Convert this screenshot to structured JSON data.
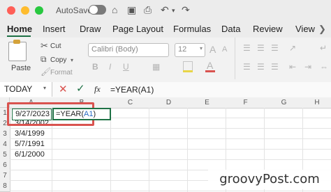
{
  "titlebar": {
    "autosave_label": "AutoSave"
  },
  "ribbon_tabs": [
    "Home",
    "Insert",
    "Draw",
    "Page Layout",
    "Formulas",
    "Data",
    "Review",
    "View"
  ],
  "clipboard": {
    "paste_label": "Paste",
    "cut_label": "Cut",
    "copy_label": "Copy",
    "format_label": "Format"
  },
  "font": {
    "name": "Calibri (Body)",
    "size": "12"
  },
  "formula_bar": {
    "name_box": "TODAY",
    "fx_label": "fx",
    "formula": "=YEAR(A1)"
  },
  "grid": {
    "columns": [
      "A",
      "B",
      "C",
      "D",
      "E",
      "F",
      "G",
      "H"
    ],
    "rows": [
      "1",
      "2",
      "3",
      "4",
      "5",
      "6",
      "7",
      "8"
    ],
    "cells": {
      "A1": "9/27/2023",
      "B1": "=YEAR(A1)",
      "B1_prefix": "=YEAR(",
      "B1_ref": "A1",
      "B1_suffix": ")",
      "A2": "3/14/2002",
      "A3": "3/4/1999",
      "A4": "5/7/1991",
      "A5": "6/1/2000"
    }
  },
  "watermark": "groovyPost.com",
  "colors": {
    "excel_green": "#1e7145",
    "highlight_red": "#d9534f",
    "reference_blue": "#2b6cc4"
  }
}
